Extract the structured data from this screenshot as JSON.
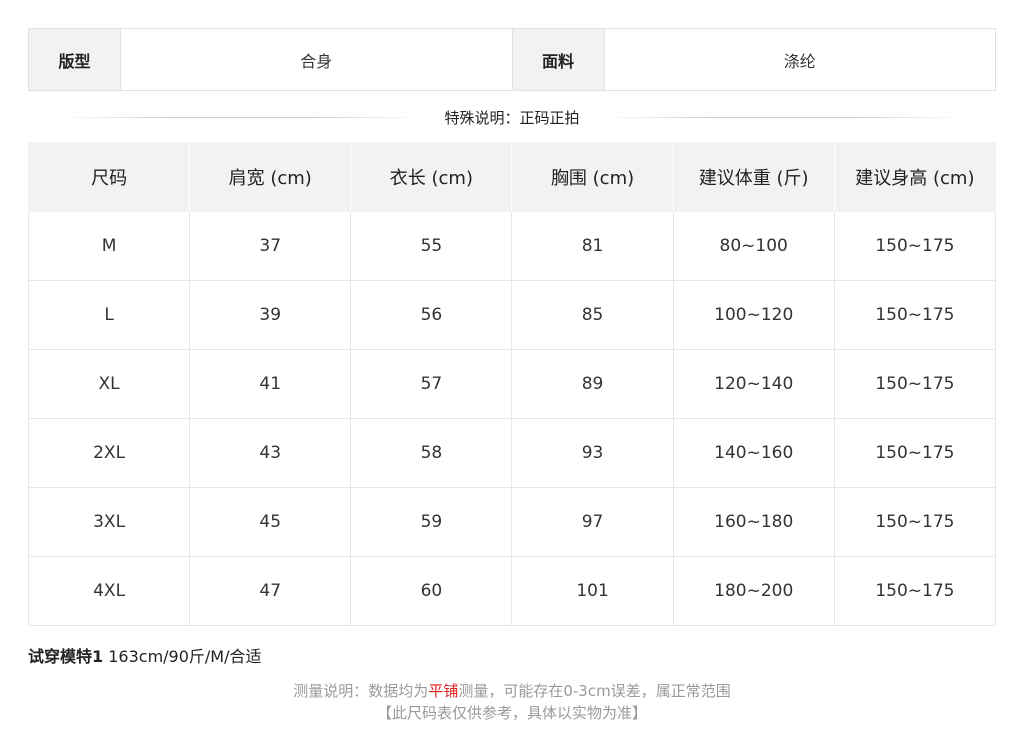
{
  "attributes": {
    "fit_label": "版型",
    "fit_value": "合身",
    "fabric_label": "面料",
    "fabric_value": "涤纶"
  },
  "special_note": "特殊说明：正码正拍",
  "size_table": {
    "headers": [
      "尺码",
      "肩宽 (cm)",
      "衣长 (cm)",
      "胸围 (cm)",
      "建议体重 (斤)",
      "建议身高 (cm)"
    ],
    "rows": [
      [
        "M",
        "37",
        "55",
        "81",
        "80~100",
        "150~175"
      ],
      [
        "L",
        "39",
        "56",
        "85",
        "100~120",
        "150~175"
      ],
      [
        "XL",
        "41",
        "57",
        "89",
        "120~140",
        "150~175"
      ],
      [
        "2XL",
        "43",
        "58",
        "93",
        "140~160",
        "150~175"
      ],
      [
        "3XL",
        "45",
        "59",
        "97",
        "160~180",
        "150~175"
      ],
      [
        "4XL",
        "47",
        "60",
        "101",
        "180~200",
        "150~175"
      ]
    ]
  },
  "model": {
    "label": "试穿模特1",
    "info": " 163cm/90斤/M/合适"
  },
  "measure_note": {
    "prefix": "测量说明：数据均为",
    "highlight": "平铺",
    "suffix": "测量，可能存在0-3cm误差，属正常范围",
    "disclaimer": "【此尺码表仅供参考，具体以实物为准】"
  },
  "colors": {
    "header_bg": "#f2f2f2",
    "border": "#e6e6e6",
    "highlight": "#e02020",
    "note_text": "#9a9a9a"
  }
}
